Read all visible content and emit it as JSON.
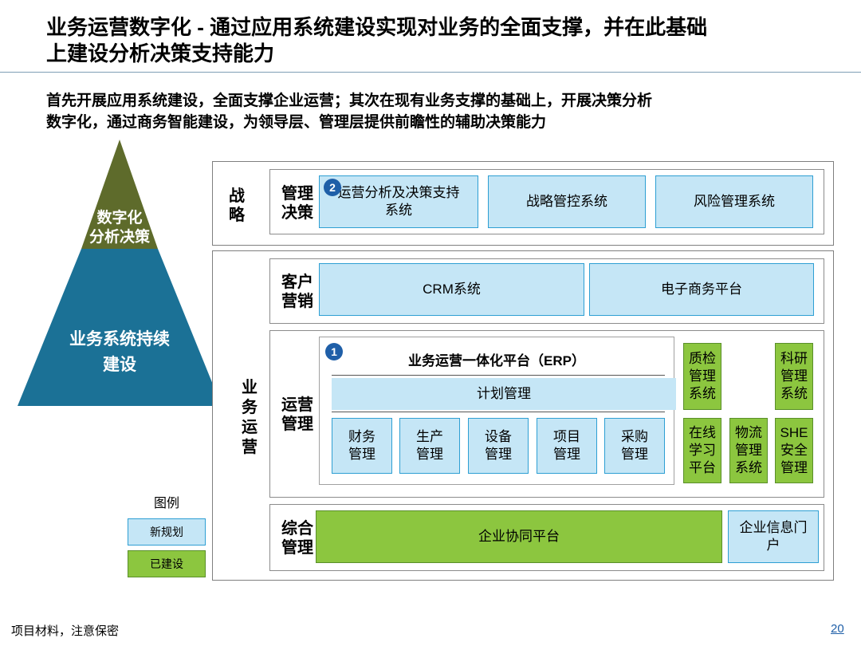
{
  "header": {
    "title_line1": "业务运营数字化 - 通过应用系统建设实现对业务的全面支撑，并在此基础",
    "title_line2": "上建设分析决策支持能力",
    "subtitle_line1": "首先开展应用系统建设，全面支撑企业运营；其次在现有业务支撑的基础上，开展决策分析",
    "subtitle_line2": "数字化，通过商务智能建设，为领导层、管理层提供前瞻性的辅助决策能力"
  },
  "pyramid": {
    "top_line1": "数字化",
    "top_line2": "分析决策",
    "bottom_line1": "业务系统持续",
    "bottom_line2": "建设",
    "colors": {
      "top": "#5e6b2b",
      "bottom": "#1b7196"
    }
  },
  "strategy": {
    "label_line1": "战",
    "label_line2": "略",
    "row_label_line1": "管理",
    "row_label_line2": "决策",
    "boxes": {
      "analysis_line1": "运营分析及决策支持",
      "analysis_line2": "系统",
      "analysis_badge": "2",
      "control": "战略管控系统",
      "risk": "风险管理系统"
    }
  },
  "business": {
    "label_line1": "业",
    "label_line2": "务",
    "label_line3": "运",
    "label_line4": "营",
    "crm_row": {
      "label_line1": "客户",
      "label_line2": "营销",
      "crm": "CRM系统",
      "ecommerce": "电子商务平台"
    },
    "ops_row": {
      "label_line1": "运营",
      "label_line2": "管理",
      "erp_badge": "1",
      "erp_title": "业务运营一体化平台（ERP）",
      "plan": "计划管理",
      "modules": [
        {
          "line1": "财务",
          "line2": "管理"
        },
        {
          "line1": "生产",
          "line2": "管理"
        },
        {
          "line1": "设备",
          "line2": "管理"
        },
        {
          "line1": "项目",
          "line2": "管理"
        },
        {
          "line1": "采购",
          "line2": "管理"
        }
      ],
      "side": {
        "quality": {
          "line1": "质检",
          "line2": "管理",
          "line3": "系统"
        },
        "research": {
          "line1": "科研",
          "line2": "管理",
          "line3": "系统"
        },
        "learning": {
          "line1": "在线",
          "line2": "学习",
          "line3": "平台"
        },
        "logistics": {
          "line1": "物流",
          "line2": "管理",
          "line3": "系统"
        },
        "she": {
          "line1": "SHE",
          "line2": "安全",
          "line3": "管理"
        }
      }
    },
    "general_row": {
      "label_line1": "综合",
      "label_line2": "管理",
      "collab": "企业协同平台",
      "portal_line1": "企业信息门",
      "portal_line2": "户"
    }
  },
  "legend": {
    "title": "图例",
    "new": "新规划",
    "built": "已建设",
    "colors": {
      "new": "#c5e6f6",
      "built": "#8cc63f"
    }
  },
  "footer": {
    "note": "项目材料，注意保密",
    "page": "20"
  }
}
